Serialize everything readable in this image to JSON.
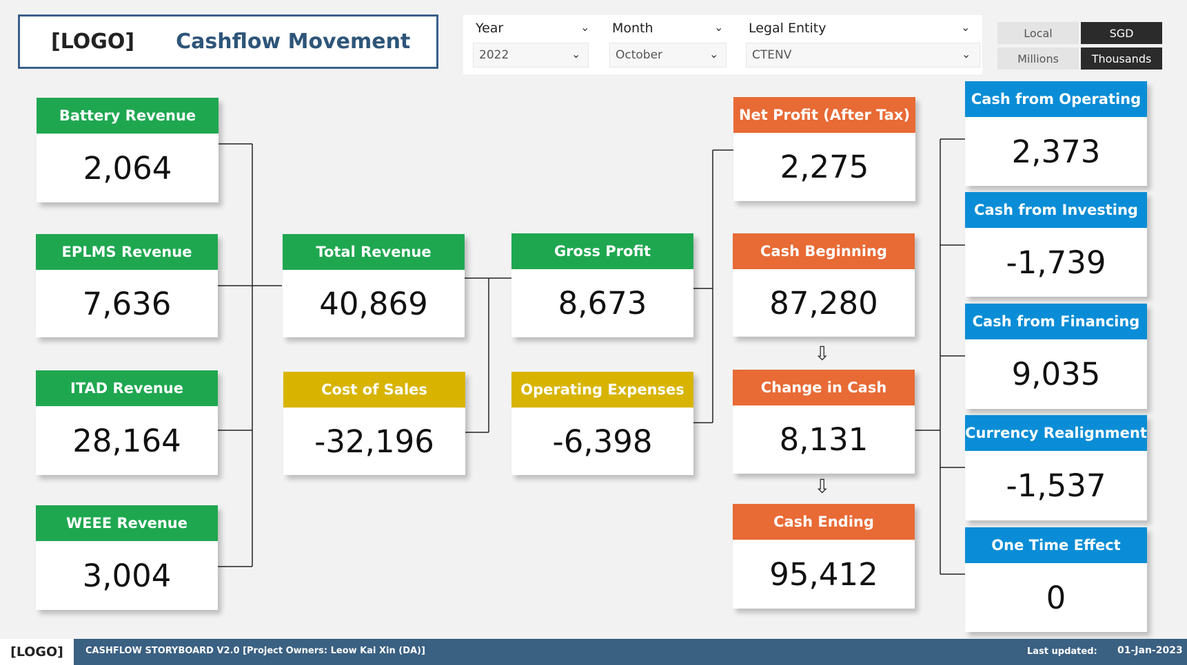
{
  "header": {
    "logo": "[LOGO]",
    "title": "Cashflow Movement"
  },
  "filters": {
    "year": {
      "label": "Year",
      "value": "2022"
    },
    "month": {
      "label": "Month",
      "value": "October"
    },
    "entity": {
      "label": "Legal Entity",
      "value": "CTENV"
    }
  },
  "toggles": {
    "local": "Local",
    "sgd": "SGD",
    "millions": "Millions",
    "thousands": "Thousands",
    "selected_currency": "SGD",
    "selected_unit": "Thousands"
  },
  "cards": {
    "battery": {
      "title": "Battery Revenue",
      "value": "2,064"
    },
    "eplms": {
      "title": "EPLMS Revenue",
      "value": "7,636"
    },
    "itad": {
      "title": "ITAD Revenue",
      "value": "28,164"
    },
    "weee": {
      "title": "WEEE Revenue",
      "value": "3,004"
    },
    "total_revenue": {
      "title": "Total Revenue",
      "value": "40,869"
    },
    "cost_of_sales": {
      "title": "Cost of Sales",
      "value": "-32,196"
    },
    "gross_profit": {
      "title": "Gross Profit",
      "value": "8,673"
    },
    "opex": {
      "title": "Operating Expenses",
      "value": "-6,398"
    },
    "net_profit": {
      "title": "Net Profit (After Tax)",
      "value": "2,275"
    },
    "cash_beginning": {
      "title": "Cash Beginning",
      "value": "87,280"
    },
    "change_in_cash": {
      "title": "Change in Cash",
      "value": "8,131"
    },
    "cash_ending": {
      "title": "Cash Ending",
      "value": "95,412"
    },
    "cash_operating": {
      "title": "Cash from Operating",
      "value": "2,373"
    },
    "cash_investing": {
      "title": "Cash from Investing",
      "value": "-1,739"
    },
    "cash_financing": {
      "title": "Cash from Financing",
      "value": "9,035"
    },
    "currency_realignment": {
      "title": "Currency Realignment",
      "value": "-1,537"
    },
    "one_time_effect": {
      "title": "One Time Effect",
      "value": "0"
    }
  },
  "colors": {
    "revenue": "#1fa750",
    "cost": "#d8b400",
    "cash": "#e86a35",
    "cashflow": "#0a8dd6",
    "footer": "#3a6082"
  },
  "footer": {
    "logo": "[LOGO]",
    "text": "CASHFLOW STORYBOARD V2.0  [Project Owners: Leow Kai Xin (DA)]",
    "last_updated_label": "Last updated:",
    "last_updated_value": "01-Jan-2023"
  }
}
